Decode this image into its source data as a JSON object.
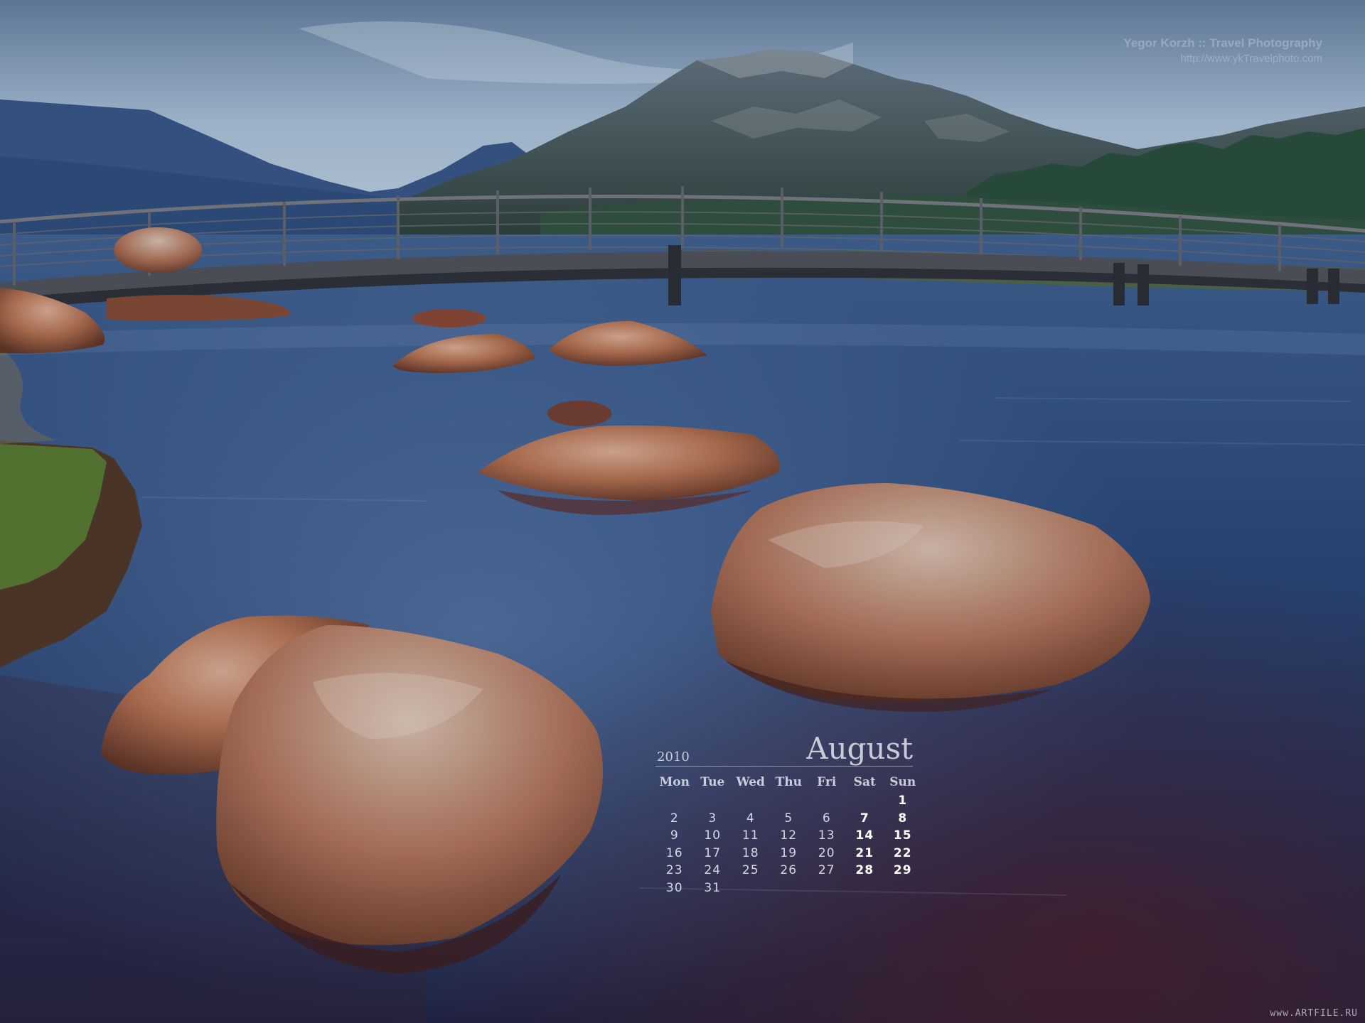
{
  "credit": {
    "line1": "Yegor Korzh :: Travel Photography",
    "line2": "http://www.ykTravelphoto.com"
  },
  "calendar": {
    "year": "2010",
    "month": "August",
    "weekdays": [
      "Mon",
      "Tue",
      "Wed",
      "Thu",
      "Fri",
      "Sat",
      "Sun"
    ],
    "first_weekday_index": 6,
    "days_in_month": 31,
    "weekend_columns": [
      5,
      6
    ]
  },
  "watermark": "www.ARTFILE.RU",
  "colors": {
    "sky": "#9fb3c9",
    "water": "#1d3158",
    "rock": "#9a5a40"
  }
}
